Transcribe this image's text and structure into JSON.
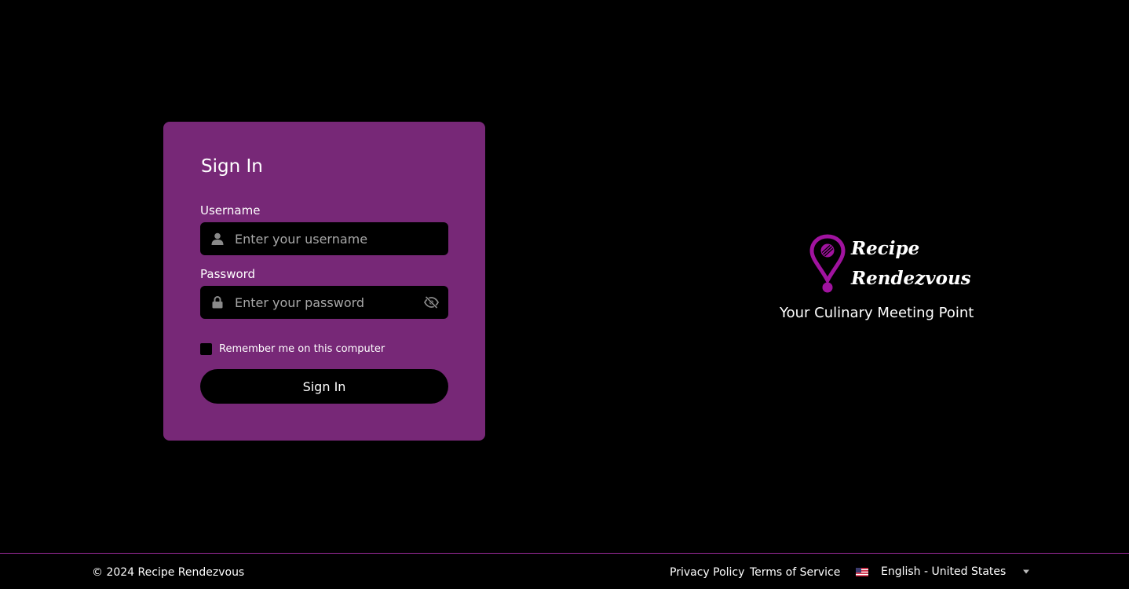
{
  "signin": {
    "title": "Sign In",
    "username_label": "Username",
    "username_placeholder": "Enter your username",
    "username_value": "",
    "password_label": "Password",
    "password_placeholder": "Enter your password",
    "password_value": "",
    "remember_label": "Remember me on this computer",
    "remember_checked": false,
    "submit_label": "Sign In"
  },
  "brand": {
    "name_line1": "Recipe",
    "name_line2": "Rendezvous",
    "tagline": "Your Culinary Meeting Point",
    "logo_icon": "map-pin-icon"
  },
  "footer": {
    "copyright": "© 2024 Recipe Rendezvous",
    "links": [
      "Privacy Policy",
      "Terms of Service"
    ],
    "language": "English - United States",
    "flag_icon": "us-flag-icon"
  },
  "colors": {
    "background": "#000000",
    "card": "#772877",
    "accent": "#a0139f",
    "footer_border": "#9b2a9b",
    "placeholder": "#a8a8a8"
  }
}
